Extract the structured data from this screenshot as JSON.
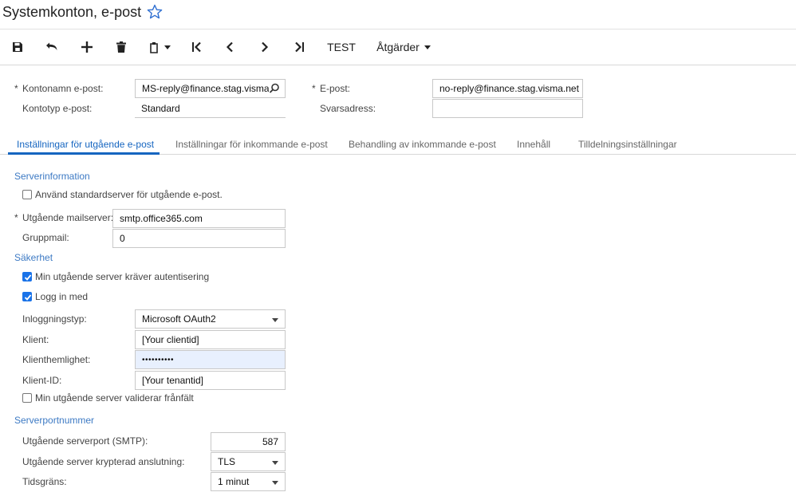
{
  "page": {
    "title": "Systemkonton, e-post"
  },
  "toolbar": {
    "test_label": "TEST",
    "actions_label": "Åtgärder",
    "icons": [
      "save-icon",
      "undo-icon",
      "add-icon",
      "delete-icon",
      "copy-paste-icon",
      "first-icon",
      "previous-icon",
      "next-icon",
      "last-icon"
    ]
  },
  "header": {
    "account_name_label": "Kontonamn e-post:",
    "account_name_value": "MS-reply@finance.stag.visma.n",
    "account_type_label": "Kontotyp e-post:",
    "account_type_value": "Standard",
    "email_label": "E-post:",
    "email_value": "no-reply@finance.stag.visma.net",
    "reply_label": "Svarsadress:",
    "reply_value": ""
  },
  "tabs": [
    {
      "label": "Inställningar för utgående e-post",
      "active": true
    },
    {
      "label": "Inställningar för inkommande e-post",
      "active": false
    },
    {
      "label": "Behandling av inkommande e-post",
      "active": false
    },
    {
      "label": "Innehåll",
      "active": false
    },
    {
      "label": "Tilldelningsinställningar",
      "active": false
    }
  ],
  "server_info": {
    "section_label": "Serverinformation",
    "use_default_label": "Använd standardserver för utgående e-post.",
    "use_default_checked": false,
    "outgoing_server_label": "Utgående mailserver:",
    "outgoing_server_value": "smtp.office365.com",
    "group_mail_label": "Gruppmail:",
    "group_mail_value": "0"
  },
  "security": {
    "section_label": "Säkerhet",
    "requires_auth_label": "Min utgående server kräver autentisering",
    "requires_auth_checked": true,
    "login_with_label": "Logg in med",
    "login_with_checked": true,
    "login_type_label": "Inloggningstyp:",
    "login_type_value": "Microsoft OAuth2",
    "client_label": "Klient:",
    "client_value": "[Your clientid]",
    "client_secret_label": "Klienthemlighet:",
    "client_secret_value": "••••••••••",
    "client_id_label": "Klient-ID:",
    "client_id_value": "[Your tenantid]",
    "validates_label": "Min utgående server validerar frånfält",
    "validates_checked": false
  },
  "ports": {
    "section_label": "Serverportnummer",
    "smtp_port_label": "Utgående serverport (SMTP):",
    "smtp_port_value": "587",
    "encrypted_label": "Utgående server krypterad anslutning:",
    "encrypted_value": "TLS",
    "timeout_label": "Tidsgräns:",
    "timeout_value": "1 minut"
  },
  "colors": {
    "accent": "#1565c0",
    "section": "#3d7ac4",
    "checkbox": "#1a73e8",
    "highlight": "#e8f0fe"
  }
}
